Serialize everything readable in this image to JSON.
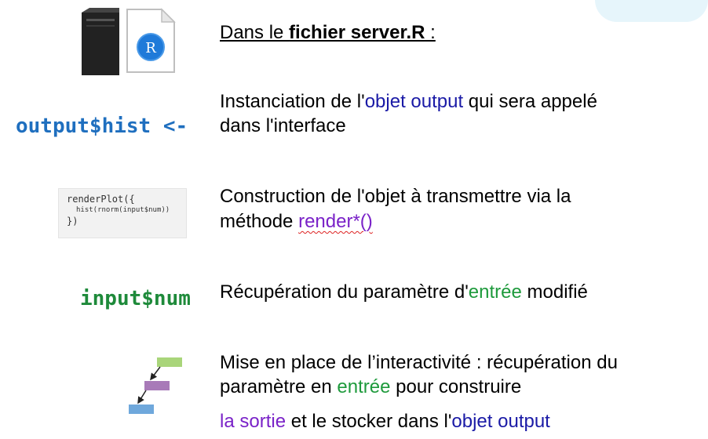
{
  "header": {
    "prefix": "Dans le ",
    "bold": "fichier server.R",
    "suffix": " :"
  },
  "rows": [
    {
      "code": "output$hist <-",
      "line1": [
        "Instanciation de l'",
        "objet output",
        " qui sera appelé"
      ],
      "line2": "dans l'interface"
    },
    {
      "code_lines": [
        "renderPlot({",
        "hist(rnorm(input$num))",
        "})"
      ],
      "line1": "Construction de l'objet à transmettre via la",
      "line2": [
        "méthode ",
        "render*()"
      ]
    },
    {
      "code": "input$num",
      "line1": [
        "Récupération du paramètre d'",
        "entrée",
        " modifié"
      ]
    },
    {
      "line1": "Mise en place de l’interactivité : récupération du",
      "line2": [
        "paramètre en ",
        "entrée",
        " pour construire"
      ],
      "line3": [
        "la sortie",
        " et le stocker dans l'",
        "objet output"
      ]
    }
  ],
  "colors": {
    "blue": "#1a1aa6",
    "green": "#1e9a3c",
    "purple": "#7a22c8",
    "code_blue": "#1f6fbf",
    "code_green": "#1e8a3a"
  },
  "icons": [
    "server-tower-icon",
    "r-file-icon",
    "flow-diagram-icon"
  ]
}
